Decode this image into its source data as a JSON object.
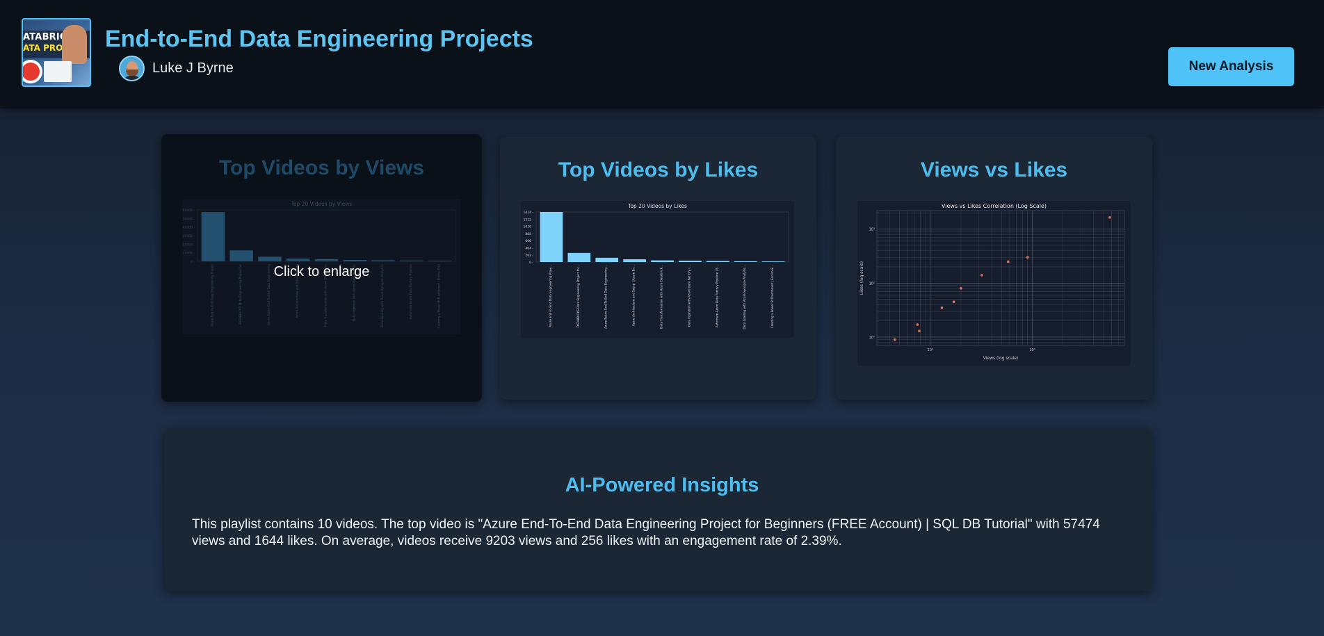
{
  "header": {
    "thumbnail": {
      "line1": "ATABRICKS",
      "line2": "ATA PROJECT"
    },
    "title": "End-to-End Data Engineering Projects",
    "author": "Luke J Byrne",
    "new_analysis_label": "New Analysis"
  },
  "cards": {
    "views": {
      "heading": "Top Videos by Views",
      "overlay": "Click to enlarge"
    },
    "likes": {
      "heading": "Top Videos by Likes"
    },
    "scatter": {
      "heading": "Views vs Likes"
    }
  },
  "insights": {
    "title": "AI-Powered Insights",
    "text": "This playlist contains 10 videos. The top video is \"Azure End-To-End Data Engineering Project for Beginners (FREE Account) | SQL DB Tutorial\" with 57474 views and 1644 likes. On average, videos receive 9203 views and 256 likes with an engagement rate of 2.39%."
  },
  "chart_data": [
    {
      "type": "bar",
      "title": "Top 20 Videos by Views",
      "color": "#5ec4f2",
      "ylim": [
        0,
        60000
      ],
      "ytick_labels": [
        "0",
        "10000",
        "20000",
        "30000",
        "40000",
        "50000",
        "60000"
      ],
      "categories": [
        "Azure End-To-End Data Engineering Project",
        "DATABRICKS Data Engineering Project for",
        "Azure Fabric End-To-End Data Engineering",
        "Azure Architecture and Setup | Azure",
        "Data Transformation with Azure Databricks",
        "Data Ingestion with Azure Data Factory",
        "Data Loading with Azure Synapse Analytics",
        "Automate Azure Data Factory Pipeline",
        "Creating a Power BI Dashboard | End-to-End"
      ],
      "values": [
        57474,
        12800,
        5400,
        3300,
        2600,
        1700,
        1300,
        1000,
        800
      ]
    },
    {
      "type": "bar",
      "title": "Top 20 Videos by Likes",
      "color": "#7fd3fb",
      "ylim": [
        0,
        1644
      ],
      "ytick_labels": [
        "0",
        "202",
        "404",
        "606",
        "808",
        "1010",
        "1212",
        "1414"
      ],
      "categories": [
        "Azure End-To-End Data Engineering Proje...",
        "DATABRICKS Data Engineering Project for...",
        "Azure Fabric End-To-End Data Engineering...",
        "Azure Architecture and Setup | Azure En...",
        "Data Transformation with Azure Databrick...",
        "Data Ingestion with Azure Data Factory (...",
        "Automate Azure Data Factory Pipeline | E...",
        "Data Loading with Azure Synapse Analytic...",
        "Creating a Power BI Dashboard | End-to-E..."
      ],
      "values": [
        1644,
        300,
        140,
        90,
        55,
        45,
        35,
        25,
        20
      ]
    },
    {
      "type": "scatter",
      "title": "Views vs Likes Correlation (Log Scale)",
      "xlabel": "Views (log scale)",
      "ylabel": "Likes (log scale)",
      "log_scale": true,
      "grid": true,
      "color": "#e8735a",
      "x": [
        450,
        750,
        780,
        1300,
        1700,
        2000,
        3200,
        5800,
        9000,
        57474
      ],
      "y": [
        9,
        17,
        13,
        35,
        45,
        80,
        140,
        250,
        300,
        1644
      ]
    }
  ]
}
